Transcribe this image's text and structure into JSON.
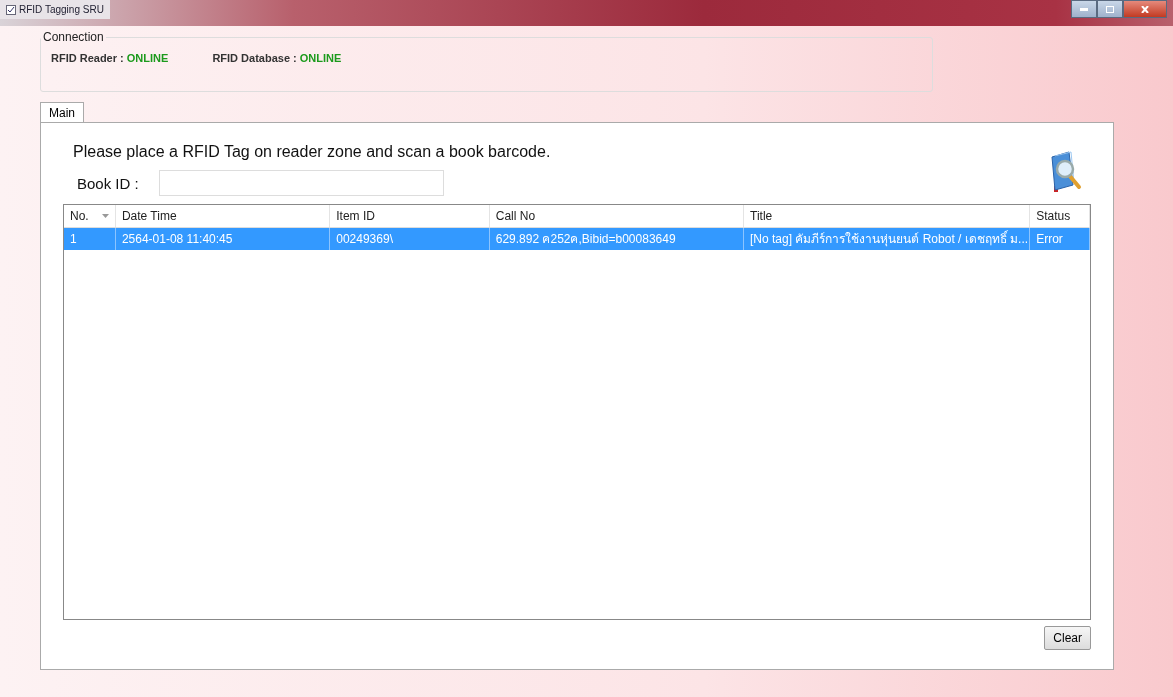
{
  "window": {
    "title": "RFID Tagging SRU"
  },
  "connection": {
    "title": "Connection",
    "items": [
      {
        "label": "RFID Reader :",
        "value": "ONLINE"
      },
      {
        "label": "RFID Database :",
        "value": "ONLINE"
      }
    ]
  },
  "tabs": [
    {
      "label": "Main",
      "selected": true
    }
  ],
  "instruction": "Please place a RFID Tag on reader zone and scan a book barcode.",
  "book_id": {
    "label": "Book ID :"
  },
  "table": {
    "columns": [
      "No.",
      "Date Time",
      "Item ID",
      "Call No",
      "Title",
      "Status"
    ],
    "rows": [
      {
        "selected": true,
        "cells": [
          "1",
          "2564-01-08 11:40:45",
          "00249369\\",
          "629.892 ค252ค,Bibid=b00083649",
          "[No tag] คัมภีร์การใช้งานหุ่นยนต์ Robot / เดชฤทธิ์ ม...",
          "Error"
        ]
      }
    ]
  },
  "buttons": [
    "Clear"
  ]
}
